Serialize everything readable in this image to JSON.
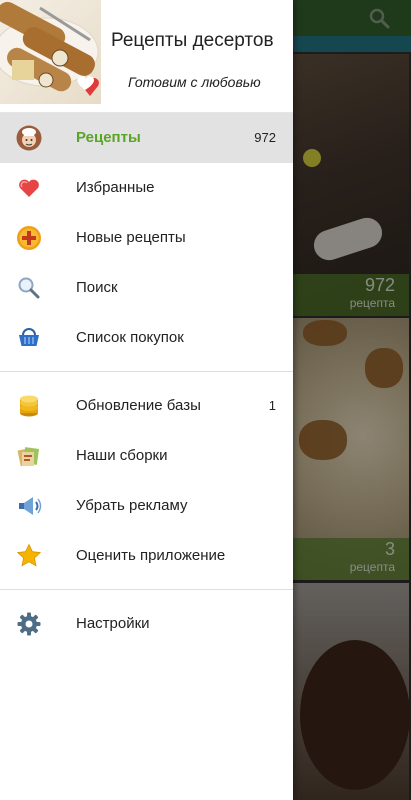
{
  "drawer": {
    "header": {
      "title": "Рецепты десертов",
      "subtitle": "Готовим с любовью"
    },
    "items": [
      {
        "label": "Рецепты",
        "count": "972",
        "icon": "chef-icon",
        "active": true
      },
      {
        "label": "Избранные",
        "count": "",
        "icon": "heart-icon"
      },
      {
        "label": "Новые рецепты",
        "count": "",
        "icon": "plus-circle-icon"
      },
      {
        "label": "Поиск",
        "count": "",
        "icon": "search-icon"
      },
      {
        "label": "Список покупок",
        "count": "",
        "icon": "basket-icon"
      },
      {
        "label": "Обновление базы",
        "count": "1",
        "icon": "database-icon"
      },
      {
        "label": "Наши сборки",
        "count": "",
        "icon": "collection-icon"
      },
      {
        "label": "Убрать рекламу",
        "count": "",
        "icon": "megaphone-icon"
      },
      {
        "label": "Оценить приложение",
        "count": "",
        "icon": "star-icon"
      },
      {
        "label": "Настройки",
        "count": "",
        "icon": "gear-icon"
      }
    ]
  },
  "background": {
    "cards": [
      {
        "count": "972",
        "unit": "рецепта"
      },
      {
        "count": "3",
        "unit": "рецепта"
      }
    ]
  },
  "colors": {
    "accent": "#5aa426",
    "active_row": "#e2e2e2",
    "toolbar": "#2e5a2a"
  }
}
